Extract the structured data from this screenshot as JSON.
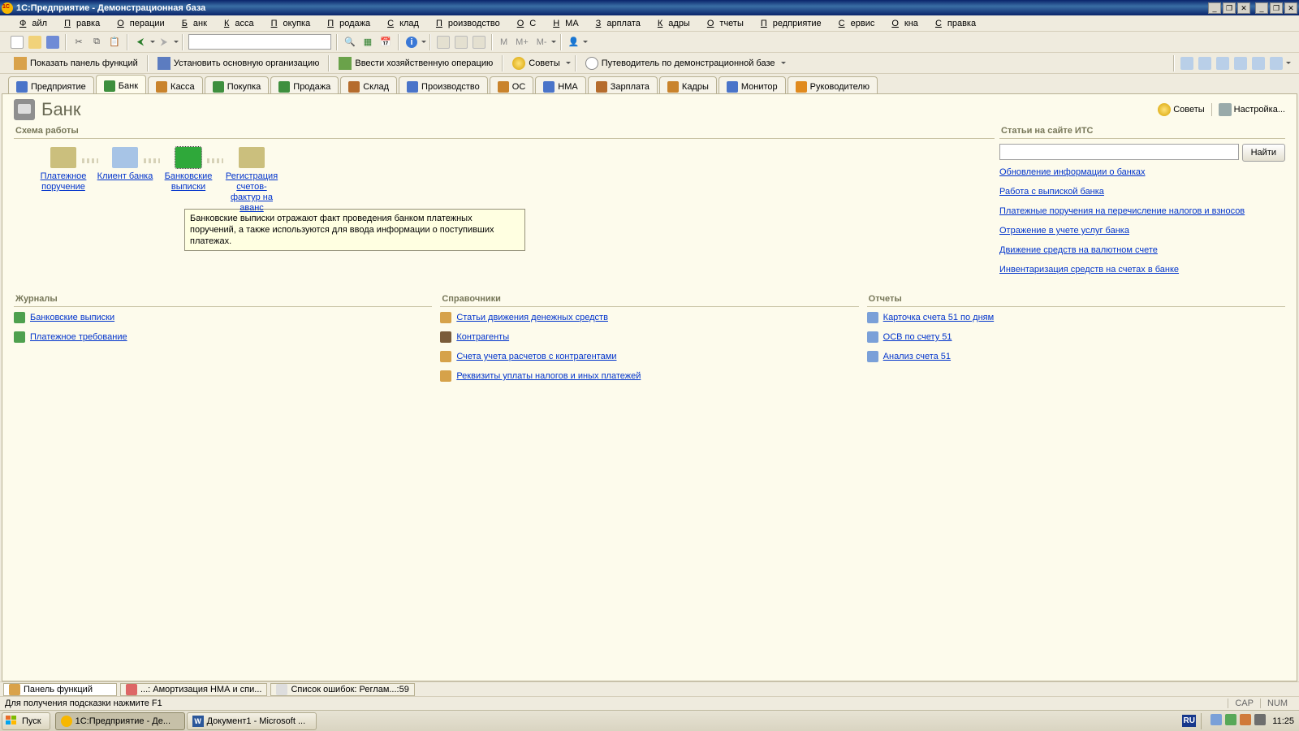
{
  "window": {
    "title": "1С:Предприятие - Демонстрационная база"
  },
  "menu": {
    "items": [
      "Файл",
      "Правка",
      "Операции",
      "Банк",
      "Касса",
      "Покупка",
      "Продажа",
      "Склад",
      "Производство",
      "ОС",
      "НМА",
      "Зарплата",
      "Кадры",
      "Отчеты",
      "Предприятие",
      "Сервис",
      "Окна",
      "Справка"
    ]
  },
  "toolbar_memory": [
    "M",
    "M+",
    "M-"
  ],
  "actionbar": {
    "show_panel": "Показать панель функций",
    "set_org": "Установить основную организацию",
    "enter_op": "Ввести хозяйственную операцию",
    "tips": "Советы",
    "guide": "Путеводитель по демонстрационной базе"
  },
  "tabs": [
    {
      "label": "Предприятие",
      "color": "#4a74c9"
    },
    {
      "label": "Банк",
      "color": "#3e8f3e"
    },
    {
      "label": "Касса",
      "color": "#c9832c"
    },
    {
      "label": "Покупка",
      "color": "#3e8f3e"
    },
    {
      "label": "Продажа",
      "color": "#3e8f3e"
    },
    {
      "label": "Склад",
      "color": "#b56c2d"
    },
    {
      "label": "Производство",
      "color": "#4a74c9"
    },
    {
      "label": "ОС",
      "color": "#c9832c"
    },
    {
      "label": "НМА",
      "color": "#4a74c9"
    },
    {
      "label": "Зарплата",
      "color": "#b56c2d"
    },
    {
      "label": "Кадры",
      "color": "#c9832c"
    },
    {
      "label": "Монитор",
      "color": "#4a74c9"
    },
    {
      "label": "Руководителю",
      "color": "#e08a1e"
    }
  ],
  "active_tab_index": 1,
  "page": {
    "title": "Банк",
    "tips": "Советы",
    "settings": "Настройка...",
    "scheme_title": "Схема работы",
    "nodes": [
      {
        "label": "Платежное поручение",
        "color": "#cbbf7d"
      },
      {
        "label": "Клиент банка",
        "color": "#a7c4e6"
      },
      {
        "label": "Банковские выписки",
        "color": "#2fa83a"
      },
      {
        "label": "Регистрация счетов-фактур на аванс",
        "color": "#cbbf7d"
      }
    ],
    "tooltip": "Банковские выписки отражают факт проведения банком платежных поручений, а также используются для ввода информации о поступивших платежах."
  },
  "its": {
    "title": "Статьи на сайте ИТС",
    "find": "Найти",
    "links": [
      "Обновление информации о банках",
      "Работа с выпиской банка",
      "Платежные поручения на перечисление налогов и взносов",
      "Отражение в учете услуг банка",
      "Движение средств на валютном счете",
      "Инвентаризация средств на счетах в банке"
    ]
  },
  "journals": {
    "title": "Журналы",
    "items": [
      "Банковские выписки",
      "Платежное требование"
    ]
  },
  "refs": {
    "title": "Справочники",
    "items": [
      "Статьи движения денежных средств",
      "Контрагенты",
      "Счета учета расчетов с контрагентами",
      "Реквизиты уплаты налогов и иных платежей"
    ]
  },
  "reports": {
    "title": "Отчеты",
    "items": [
      "Карточка счета 51 по дням",
      "ОСВ по счету 51",
      "Анализ счета 51"
    ]
  },
  "wintabs": [
    {
      "label": "Панель функций"
    },
    {
      "label": "...: Амортизация НМА и спи..."
    },
    {
      "label": "Список ошибок: Реглам...:59"
    }
  ],
  "status": {
    "hint": "Для получения подсказки нажмите F1",
    "cap": "CAP",
    "num": "NUM"
  },
  "taskbar": {
    "start": "Пуск",
    "tasks": [
      {
        "label": "1С:Предприятие - Де...",
        "active": true,
        "kind": "1c"
      },
      {
        "label": "Документ1 - Microsoft ...",
        "active": false,
        "kind": "word"
      }
    ],
    "lang": "RU",
    "clock": "11:25"
  }
}
